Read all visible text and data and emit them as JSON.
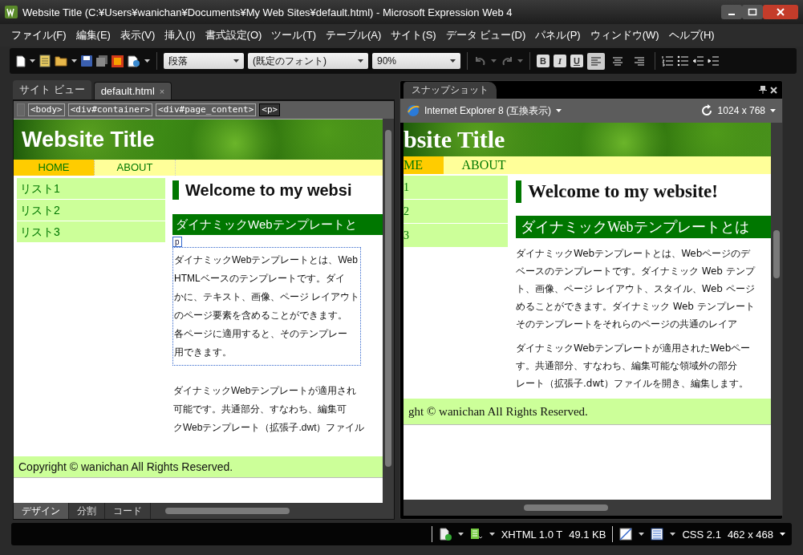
{
  "window": {
    "title": "Website Title (C:¥Users¥wanichan¥Documents¥My Web Sites¥default.html) - Microsoft Expression Web 4"
  },
  "menu": [
    "ファイル(F)",
    "編集(E)",
    "表示(V)",
    "挿入(I)",
    "書式設定(O)",
    "ツール(T)",
    "テーブル(A)",
    "サイト(S)",
    "データ ビュー(D)",
    "パネル(P)",
    "ウィンドウ(W)",
    "ヘルプ(H)"
  ],
  "toolbar": {
    "style": "段落",
    "font": "(既定のフォント)",
    "size": "90%",
    "format_buttons": [
      "B",
      "I",
      "U"
    ],
    "alignment": [
      {
        "selected": true
      },
      {
        "selected": false
      },
      {
        "selected": false
      }
    ]
  },
  "editor": {
    "tabs": [
      {
        "label": "サイト ビュー",
        "selected": false
      },
      {
        "label": "default.html",
        "selected": true,
        "close": "×"
      }
    ],
    "breadcrumb": [
      {
        "label": "<body>",
        "selected": false
      },
      {
        "label": "<div#container>",
        "selected": false
      },
      {
        "label": "<div#page_content>",
        "selected": false
      },
      {
        "label": "<p>",
        "selected": true
      }
    ],
    "page": {
      "site_title": "Website Title",
      "nav": [
        {
          "label": "HOME",
          "selected": true
        },
        {
          "label": "ABOUT",
          "selected": false
        }
      ],
      "sidebar": [
        "リスト1",
        "リスト2",
        "リスト3"
      ],
      "heading": "Welcome to my websi",
      "subheading": "ダイナミックWebテンプレートと",
      "tag_label": "p",
      "paragraphs": [
        [
          "ダイナミックWebテンプレートとは、Web",
          "HTMLベースのテンプレートです。ダイ",
          "かに、テキスト、画像、ページ レイアウト",
          "のページ要素を含めることができます。",
          "各ページに適用すると、そのテンプレー",
          "用できます。"
        ],
        [
          "ダイナミックWebテンプレートが適用され",
          "可能です。共通部分、すなわち、編集可",
          "クWebテンプレート（拡張子.dwt）ファイル"
        ]
      ],
      "footer": "Copyright © wanichan All Rights Reserved."
    },
    "view_tabs": [
      {
        "label": "デザイン",
        "selected": true
      },
      {
        "label": "分割",
        "selected": false
      },
      {
        "label": "コード",
        "selected": false
      }
    ]
  },
  "snapshot": {
    "title": "スナップショット",
    "browser": "Internet Explorer 8 (互換表示)",
    "resolution": "1024 x 768",
    "page": {
      "site_title": "bsite Title",
      "nav": [
        {
          "label": "ME",
          "selected": true
        },
        {
          "label": "ABOUT",
          "selected": false
        }
      ],
      "sidebar": [
        "1",
        "2",
        "3"
      ],
      "heading": "Welcome to my website!",
      "subheading": "ダイナミックWebテンプレートとは",
      "paragraphs": [
        [
          "ダイナミックWebテンプレートとは、Webページのデ",
          "ベースのテンプレートです。ダイナミック Web テンプ",
          "ト、画像、ページ レイアウト、スタイル、Web ページ",
          "めることができます。ダイナミック Web テンプレート",
          "そのテンプレートをそれらのページの共通のレイア"
        ],
        [
          "ダイナミックWebテンプレートが適用されたWebペー",
          "す。共通部分、すなわち、編集可能な領域外の部分",
          "レート（拡張子.dwt）ファイルを開き、編集します。"
        ]
      ],
      "footer": "ght © wanichan All Rights Reserved."
    }
  },
  "status_bar": {
    "doctype": "XHTML 1.0 T",
    "size": "49.1 KB",
    "css": "CSS 2.1",
    "dimensions": "462 x 468"
  }
}
